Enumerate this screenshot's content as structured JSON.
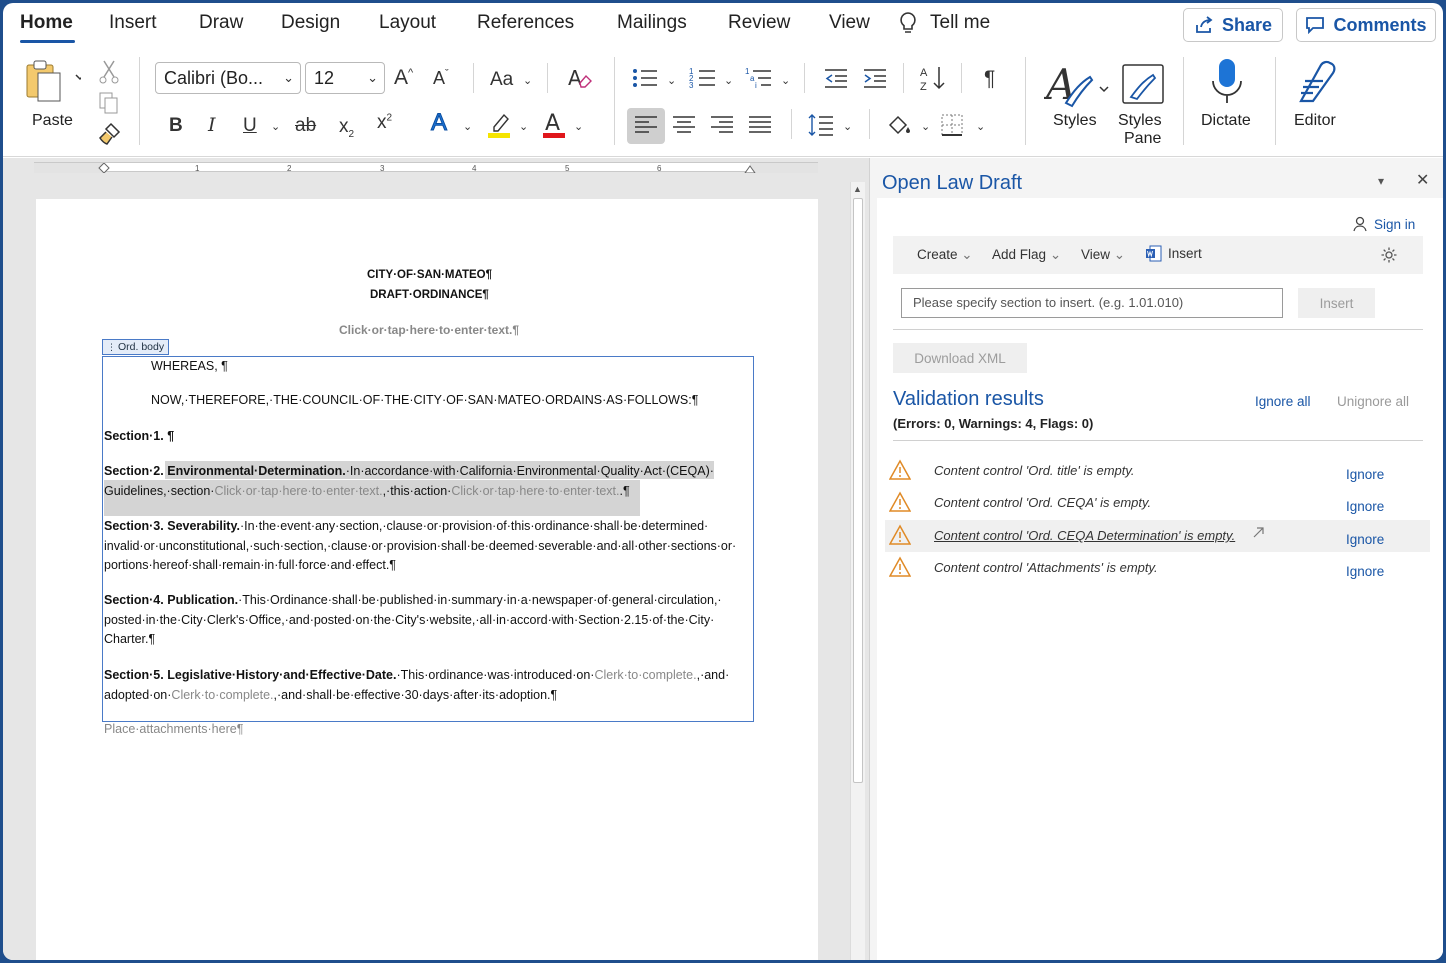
{
  "ribbon_tabs": [
    "Home",
    "Insert",
    "Draw",
    "Design",
    "Layout",
    "References",
    "Mailings",
    "Review",
    "View"
  ],
  "tell_me": "Tell me",
  "share_label": "Share",
  "comments_label": "Comments",
  "ribbon": {
    "paste": "Paste",
    "font_name": "Calibri (Bo...",
    "font_size": "12",
    "styles": "Styles",
    "styles_pane_1": "Styles",
    "styles_pane_2": "Pane",
    "dictate": "Dictate",
    "editor": "Editor",
    "glyph_bold": "B",
    "glyph_italic": "I",
    "glyph_underline": "U",
    "glyph_strike": "ab",
    "glyph_aa": "Aa",
    "glyph_pilcrow": "¶",
    "glyph_a": "A",
    "colors": {
      "highlight": "#f5e400",
      "font_red": "#e0161b",
      "text_effect": "#1d74d6"
    }
  },
  "document": {
    "heading1": "CITY·OF·SAN·MATEO¶",
    "heading2": "DRAFT·ORDINANCE¶",
    "placeholder_top": "Click·or·tap·here·to·enter·text.¶",
    "control_tag": "Ord. body",
    "whereas": "WHEREAS, ¶",
    "now_therefore": "NOW,·THEREFORE,·THE·COUNCIL·OF·THE·CITY·OF·SAN·MATEO·ORDAINS·AS·FOLLOWS:¶",
    "sec1": "Section·1. ¶",
    "sec2_head": "Section·2.",
    "sec2_title": "Environmental·Determination.",
    "sec2_l1": "·In·accordance·with·California·Environmental·Quality·Act·(CEQA)·",
    "sec2_l2a": "Guidelines,·section·",
    "sec2_l2b": "Click·or·tap·here·to·enter·text.",
    "sec2_l2c": ",·this·action·",
    "sec2_l2d": "Click·or·tap·here·to·enter·text.",
    "sec2_l2e": ".¶",
    "sec3_head": "Section·3.",
    "sec3_title": "Severability.",
    "sec3_l1": "·In·the·event·any·section,·clause·or·provision·of·this·ordinance·shall·be·determined·",
    "sec3_l2": "invalid·or·unconstitutional,·such·section,·clause·or·provision·shall·be·deemed·severable·and·all·other·sections·or·",
    "sec3_l3": "portions·hereof·shall·remain·in·full·force·and·effect.¶",
    "sec4_head": "Section·4.",
    "sec4_title": "Publication.",
    "sec4_l1": "·This·Ordinance·shall·be·published·in·summary·in·a·newspaper·of·general·circulation,·",
    "sec4_l2": "posted·in·the·City·Clerk's·Office,·and·posted·on·the·City's·website,·all·in·accord·with·Section·2.15·of·the·City·",
    "sec4_l3": "Charter.¶",
    "sec5_head": "Section·5.",
    "sec5_title": "Legislative·History·and·Effective·Date.",
    "sec5_l1a": "·This·ordinance·was·introduced·on·",
    "sec5_l1b": "Clerk·to·complete.",
    "sec5_l1c": ",·and·",
    "sec5_l2a": "adopted·on·",
    "sec5_l2b": "Clerk·to·complete.",
    "sec5_l2c": ",·and·shall·be·effective·30·days·after·its·adoption.¶",
    "attachments": "Place·attachments·here¶"
  },
  "pane": {
    "title": "Open Law Draft",
    "sign_in": "Sign in",
    "toolbar": {
      "create": "Create",
      "add_flag": "Add Flag",
      "view": "View",
      "insert": "Insert"
    },
    "section_placeholder": "Please specify section to insert. (e.g. 1.01.010)",
    "insert_button": "Insert",
    "download_xml": "Download XML",
    "validation_title": "Validation results",
    "ignore_all": "Ignore all",
    "unignore_all": "Unignore all",
    "summary": "(Errors: 0, Warnings: 4, Flags: 0)",
    "results": [
      {
        "text": "Content control 'Ord. title' is empty.",
        "action": "Ignore"
      },
      {
        "text": "Content control 'Ord. CEQA' is empty.",
        "action": "Ignore"
      },
      {
        "text": "Content control 'Ord. CEQA Determination' is empty.",
        "action": "Ignore"
      },
      {
        "text": "Content control 'Attachments' is empty.",
        "action": "Ignore"
      }
    ]
  }
}
